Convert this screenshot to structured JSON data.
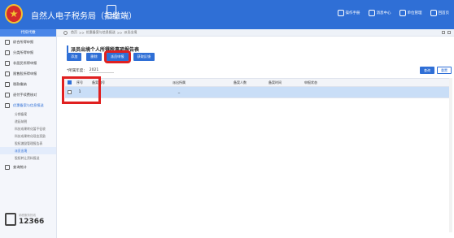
{
  "app": {
    "title": "自然人电子税务局（扣缴端）",
    "center_tool": "代扣代缴"
  },
  "top_actions": [
    {
      "label": "操作手册",
      "icon": "book-icon"
    },
    {
      "label": "消息中心",
      "icon": "mail-icon"
    },
    {
      "label": "单位管理",
      "icon": "building-icon"
    },
    {
      "label": "回首页",
      "icon": "home-icon"
    }
  ],
  "sidebar": {
    "header": "代扣代缴",
    "items": [
      {
        "label": "综合所得申报",
        "icon": "settings-icon"
      },
      {
        "label": "分类所得申报",
        "icon": "clock-icon"
      },
      {
        "label": "非居民所得申报",
        "icon": "user-icon"
      },
      {
        "label": "限售股所得申报",
        "icon": "chart-icon"
      },
      {
        "label": "税款缴纳",
        "icon": "box-icon"
      },
      {
        "label": "退付手续费核对",
        "icon": "doc-icon"
      },
      {
        "label": "优惠备案与信息报送",
        "icon": "doc-icon"
      }
    ],
    "sub_items": [
      "分期备案",
      "递延纳税",
      "科技成果转化暂不征收",
      "科技成果转化现金奖励",
      "股权激励管理报告表",
      "派员出境",
      "股权转让资料报送"
    ],
    "last_item": {
      "label": "查询统计",
      "icon": "search-icon"
    },
    "hotline_caption": "纳税服务热线",
    "hotline": "12366"
  },
  "breadcrumb": [
    "首页",
    "优惠备案与信息报送",
    "派员出境"
  ],
  "page": {
    "title": "派员出境个人所得税事项报告表",
    "buttons": [
      "添加",
      "删除",
      "派员申报",
      "获取反馈"
    ],
    "highlighted_button": "派员申报",
    "year_label": "*所属年度：",
    "year_value": "2021",
    "search_label": "查询",
    "reset_label": "重置"
  },
  "table": {
    "headers": [
      "序号",
      "备案编号",
      "派出所属",
      "备案人数",
      "备案时间",
      "申报状态"
    ],
    "rows": [
      {
        "num": "1",
        "id": "",
        "dist": "_",
        "count": "",
        "time": "",
        "status": "",
        "checked": false
      }
    ]
  }
}
